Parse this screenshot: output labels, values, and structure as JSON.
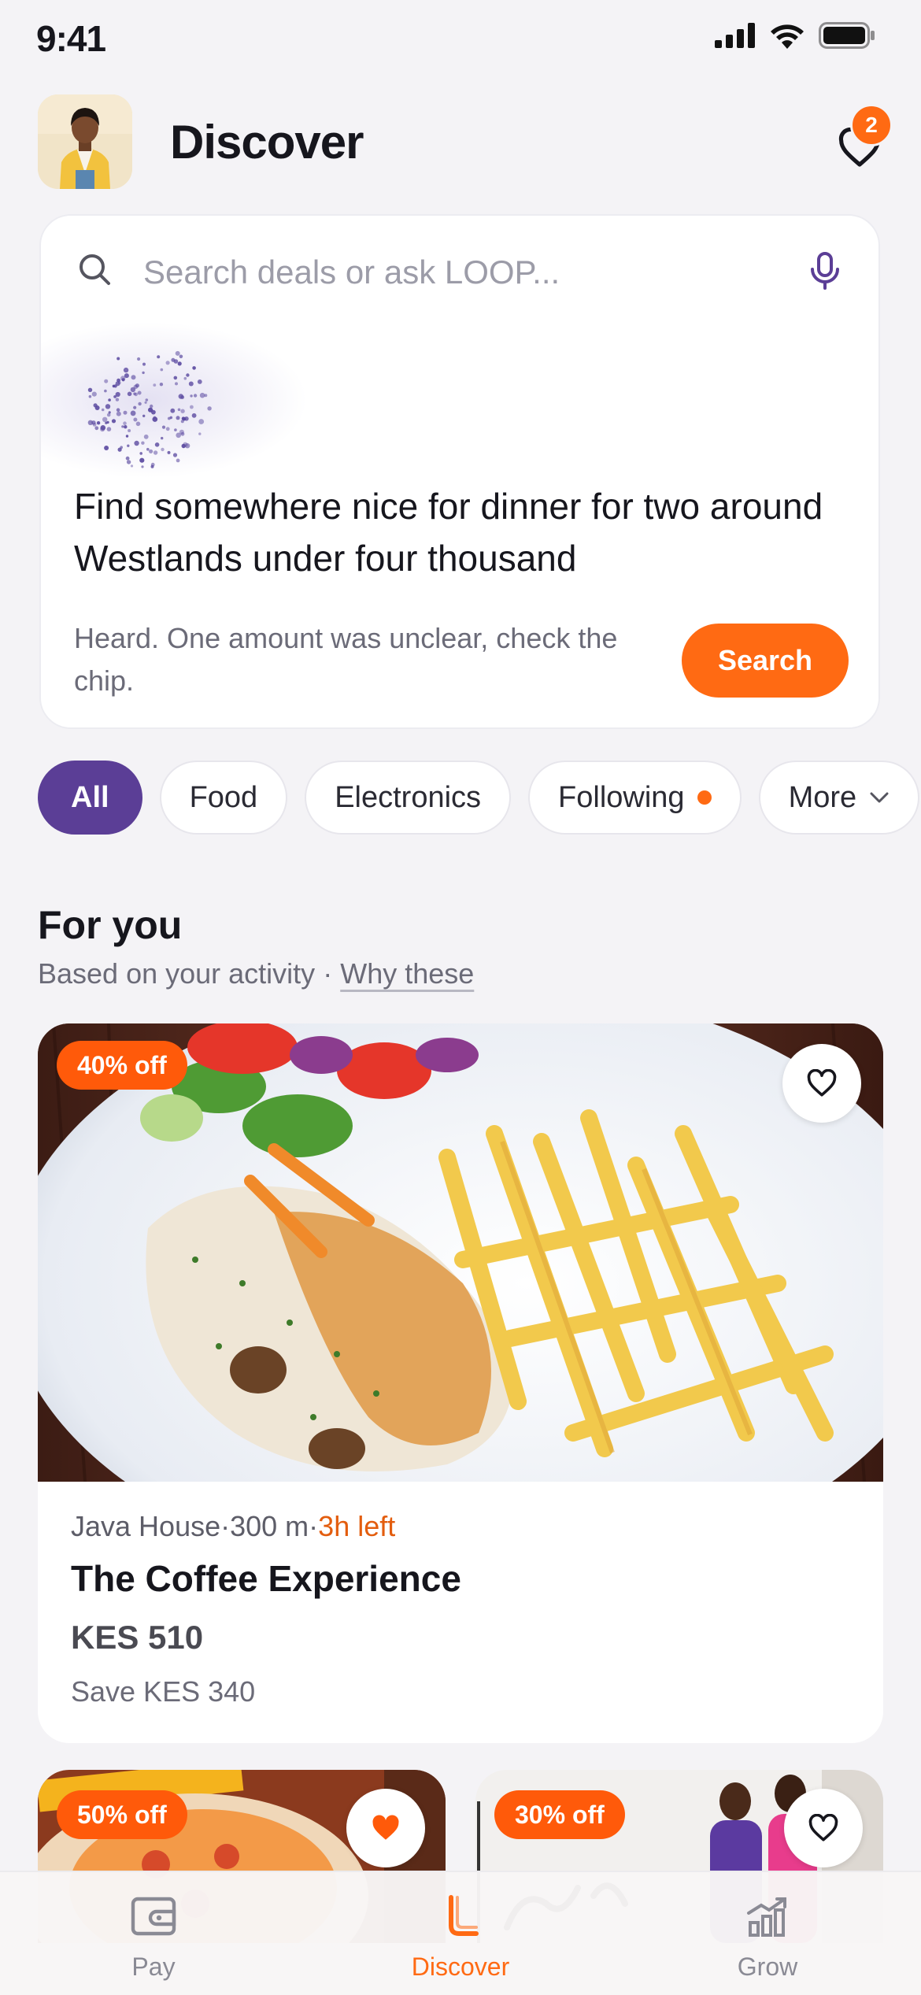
{
  "status_bar": {
    "time": "9:41"
  },
  "header": {
    "title": "Discover",
    "wishlist_count": "2"
  },
  "search": {
    "placeholder": "Search deals or ask LOOP...",
    "query": "Find somewhere nice for dinner for two around Westlands under four thousand",
    "feedback": "Heard. One amount was unclear, check the chip.",
    "button_label": "Search"
  },
  "chips": [
    {
      "label": "All",
      "active": true
    },
    {
      "label": "Food"
    },
    {
      "label": "Electronics"
    },
    {
      "label": "Following",
      "has_dot": true
    },
    {
      "label": "More"
    }
  ],
  "section": {
    "title": "For you",
    "subtitle": "Based on your activity",
    "separator": "·",
    "link": "Why these"
  },
  "featured_deal": {
    "discount": "40% off",
    "merchant": "Java House",
    "distance": "300 m",
    "time_left": "3h left",
    "title": "The Coffee Experience",
    "price": "KES 510",
    "save": "Save KES 340"
  },
  "more_deals": [
    {
      "discount": "50% off",
      "favorited": true
    },
    {
      "discount": "30% off",
      "favorited": false
    }
  ],
  "bottom_nav": [
    {
      "label": "Pay",
      "icon": "wallet-icon"
    },
    {
      "label": "Discover",
      "icon": "loop-logo-icon",
      "active": true
    },
    {
      "label": "Grow",
      "icon": "growth-chart-icon"
    }
  ],
  "colors": {
    "accent": "#ff6a13",
    "primary": "#5b3e96",
    "background": "#f4f3f6"
  }
}
